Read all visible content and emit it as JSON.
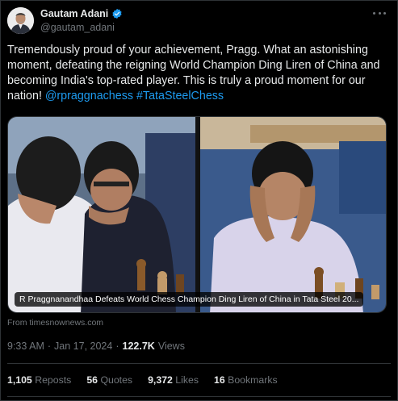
{
  "author": {
    "display_name": "Gautam Adani",
    "handle": "@gautam_adani",
    "verified_color": "#1d9bf0"
  },
  "more_icon": "more-horizontal-icon",
  "tweet": {
    "text_plain": "Tremendously proud of your achievement, Pragg. What an astonishing moment, defeating the reigning World Champion Ding Liren of China and becoming India's top-rated player. This is truly a proud moment for our nation! ",
    "mention": "@rpraggnachess",
    "hashtag": "#TataSteelChess"
  },
  "card": {
    "caption": "R Praggnanandhaa Defeats World Chess Champion Ding Liren of China in Tata Steel 20...",
    "source": "From timesnownews.com"
  },
  "meta": {
    "time": "9:33 AM",
    "separator": "·",
    "date": "Jan 17, 2024",
    "views_count": "122.7K",
    "views_label": "Views"
  },
  "stats": {
    "reposts_count": "1,105",
    "reposts_label": "Reposts",
    "quotes_count": "56",
    "quotes_label": "Quotes",
    "likes_count": "9,372",
    "likes_label": "Likes",
    "bookmarks_count": "16",
    "bookmarks_label": "Bookmarks"
  },
  "colors": {
    "background": "#000000",
    "text": "#e7e9ea",
    "secondary": "#71767b",
    "accent": "#1d9bf0",
    "border": "#2f3336"
  }
}
